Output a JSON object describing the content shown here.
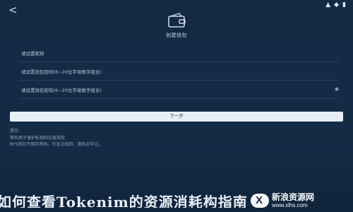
{
  "status_bar": {
    "back_icon": "chevron-left-icon",
    "signal": "▲",
    "wifi": "◆",
    "battery": "▮"
  },
  "header": {
    "title": "创建钱包"
  },
  "form": {
    "wallet_name_placeholder": "请设置昵称",
    "password_placeholder": "请设置钱包密码(6~20位字母数字组合)",
    "confirm_password_placeholder": "请设置钱包密码(6~20位字母数字组合)"
  },
  "actions": {
    "next_label": "下一步"
  },
  "notes": {
    "title": "提示:",
    "lines": [
      "密码用于保护私钥和交易授权",
      "BYS钱包不保存密码，也无法找回，请务必牢记。"
    ]
  },
  "caption": {
    "text": "如何查看Tokenim的资源消耗构指南"
  },
  "watermark": {
    "brand": "新浪资源网",
    "url": "www.xlhs.com"
  }
}
